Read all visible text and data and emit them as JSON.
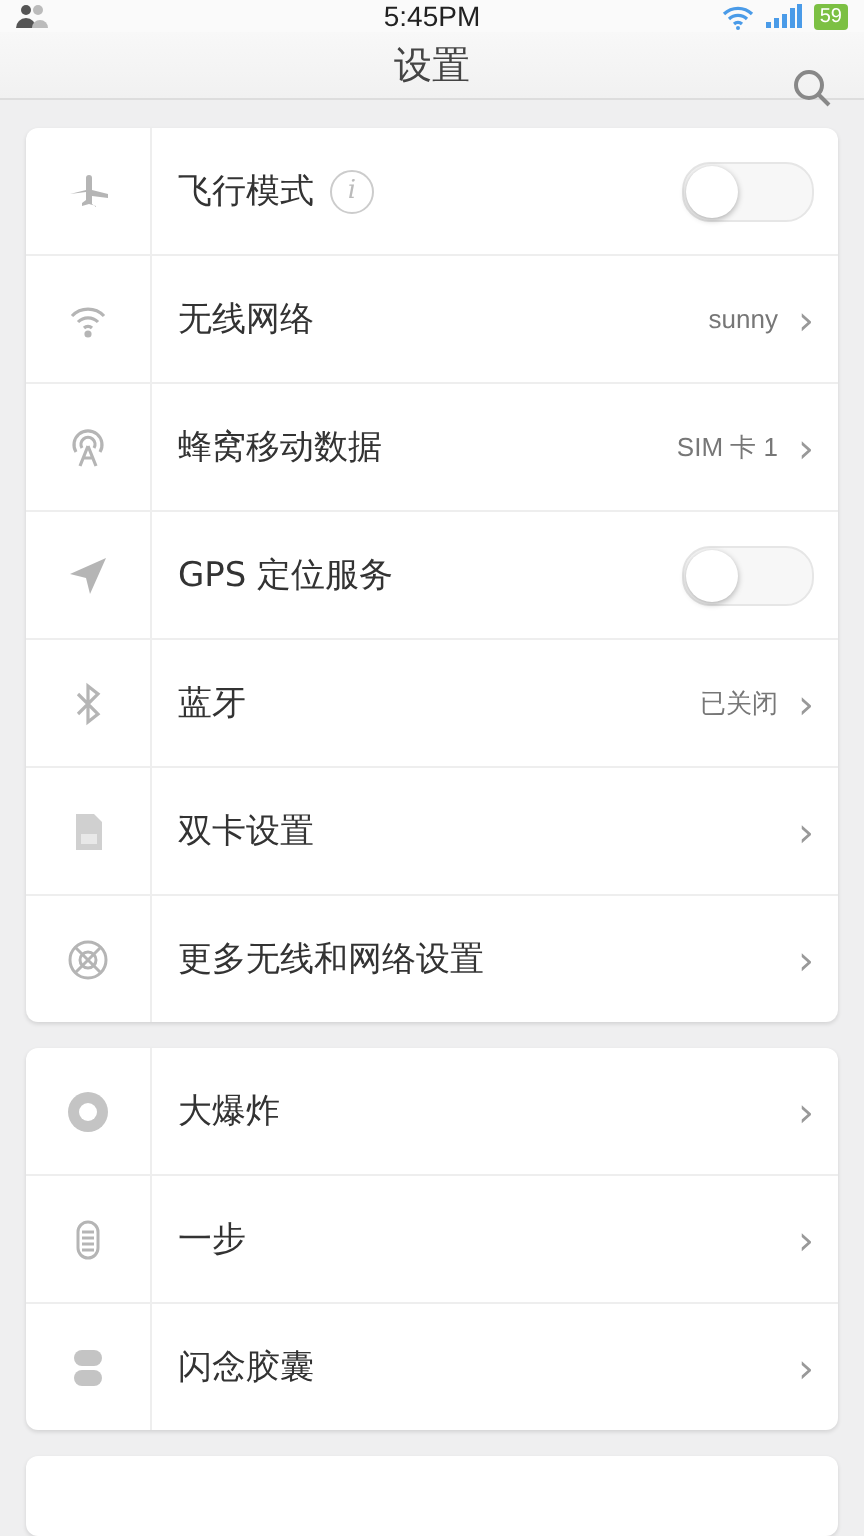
{
  "status_bar": {
    "time": "5:45PM",
    "battery": "59"
  },
  "header": {
    "title": "设置"
  },
  "groups": [
    {
      "items": [
        {
          "kind": "toggle",
          "label": "飞行模式",
          "info": "i",
          "on": false
        },
        {
          "kind": "link",
          "label": "无线网络",
          "value": "sunny",
          "chevron": "›"
        },
        {
          "kind": "link",
          "label": "蜂窝移动数据",
          "value": "SIM 卡 1",
          "chevron": "›"
        },
        {
          "kind": "toggle",
          "label": "GPS 定位服务",
          "on": false
        },
        {
          "kind": "link",
          "label": "蓝牙",
          "value": "已关闭",
          "chevron": "›"
        },
        {
          "kind": "link",
          "label": "双卡设置",
          "chevron": "›"
        },
        {
          "kind": "link",
          "label": "更多无线和网络设置",
          "chevron": "›"
        }
      ]
    },
    {
      "items": [
        {
          "kind": "link",
          "label": "大爆炸",
          "chevron": "›"
        },
        {
          "kind": "link",
          "label": "一步",
          "chevron": "›"
        },
        {
          "kind": "link",
          "label": "闪念胶囊",
          "chevron": "›"
        }
      ]
    }
  ]
}
